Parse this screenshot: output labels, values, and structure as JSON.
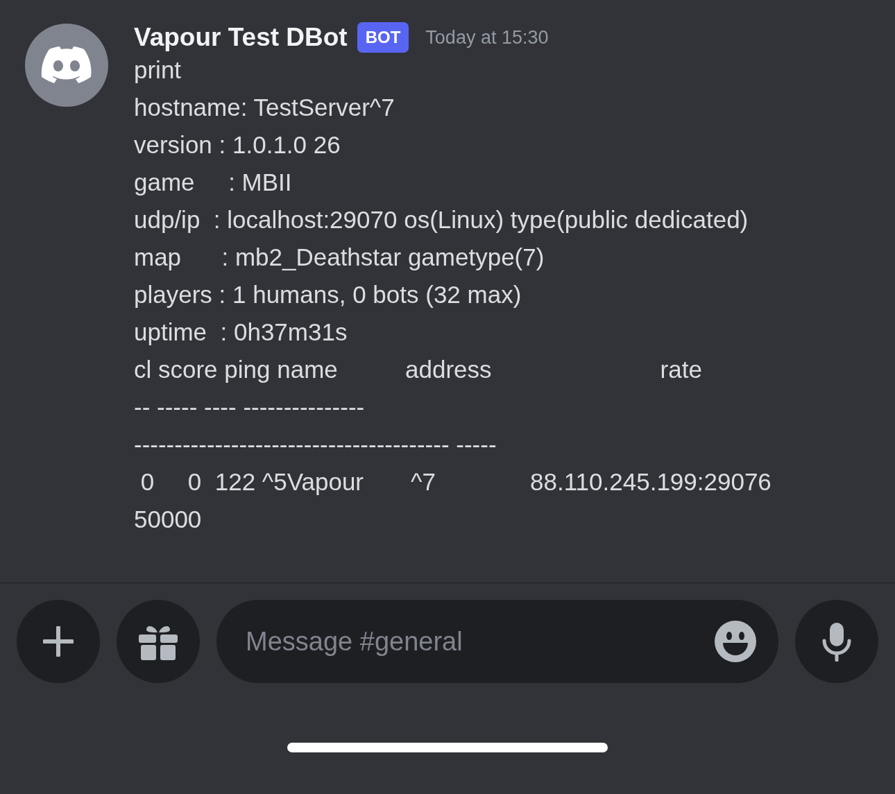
{
  "message": {
    "author": "Vapour Test DBot",
    "badge": "BOT",
    "timestamp": "Today at 15:30",
    "lines": [
      "print",
      "hostname: TestServer^7",
      "version : 1.0.1.0 26",
      "game     : MBII",
      "udp/ip  : localhost:29070 os(Linux) type(public dedicated)",
      "map      : mb2_Deathstar gametype(7)",
      "players : 1 humans, 0 bots (32 max)",
      "uptime  : 0h37m31s",
      "cl score ping name          address                         rate",
      "-- ----- ---- ---------------",
      "--------------------------------------- -----",
      " 0     0  122 ^5Vapour       ^7              88.110.245.199:29076",
      "50000"
    ]
  },
  "composer": {
    "placeholder": "Message #general"
  }
}
